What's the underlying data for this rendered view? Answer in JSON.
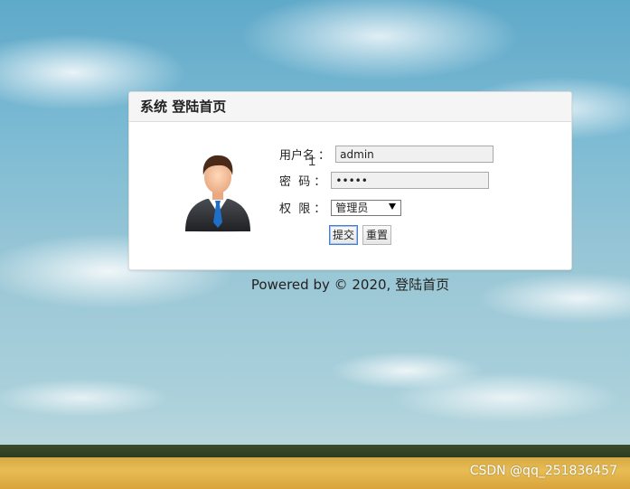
{
  "panel": {
    "title": "系统 登陆首页"
  },
  "form": {
    "username_label": "用户名",
    "username_value": "admin",
    "password_label": "密  码",
    "password_value": "•••••",
    "role_label": "权  限",
    "role_selected": "管理员",
    "colon": "："
  },
  "buttons": {
    "submit": "提交",
    "reset": "重置"
  },
  "footer": {
    "text": "Powered by © 2020, 登陆首页"
  },
  "watermark": {
    "text": "CSDN @qq_251836457"
  },
  "icons": {
    "avatar": "businessman-avatar-icon",
    "cursor": "text-cursor-icon",
    "dropdown": "triangle-down-icon"
  },
  "colors": {
    "panel_header_bg": "#f5f5f5",
    "input_bg": "#f0f0f0",
    "focus_border": "#4a7fd0"
  }
}
